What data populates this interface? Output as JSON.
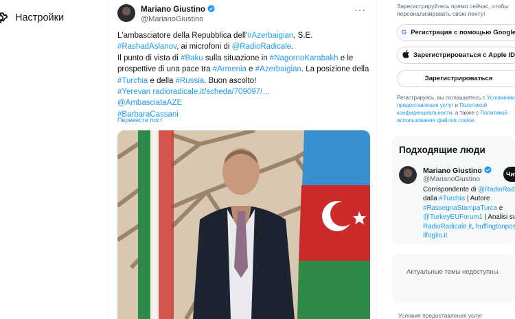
{
  "nav": {
    "settings_label": "Настройки",
    "settings_icon": "gear-icon"
  },
  "tweet": {
    "author_name": "Mariano Giustino",
    "author_handle": "@MarianoGiustino",
    "text_segments": {
      "s1": "L'ambasciatore della Repubblica dell'",
      "h1": "#Azerbaigian",
      "s2": ", S.E.",
      "h2": "#RashadAslanov",
      "s3": ", ai microfoni di ",
      "m1": "@RadioRadicale",
      "s4": ".",
      "s5": "Il punto di vista di ",
      "h3": "#Baku",
      "s6": " sulla situazione in ",
      "h4": "#NagornoKarabakh",
      "s7": " e le prospettive di una pace tra ",
      "h5": "#Armenia",
      "s8": " e ",
      "h6": "#Azerbaigian",
      "s9": ". La posizione della ",
      "h7": "#Turchia",
      "s10": " e della ",
      "h8": "#Russia",
      "s11": ". Buon ascolto!",
      "h9": "#Yerevan",
      "u1": "radioradicale.it/scheda/709097/…",
      "m2": "@AmbasciataAZE",
      "h10": "#BarbaraCassani"
    },
    "translate_label": "Перевести пост"
  },
  "signup": {
    "text": "Зарегистрируйтесь прямо сейчас, чтобы персонализировать свою ленту!",
    "google_label": "Регистрация с помощью Google",
    "apple_label": "Зарегистрироваться с Apple ID",
    "register_label": "Зарегистрироваться",
    "terms_pre": "Регистрируясь, вы соглашаетесь с ",
    "terms_link1": "Условиями предоставления услуг",
    "terms_mid": " и ",
    "terms_link2": "Политикой конфиденциальности",
    "terms_mid2": ", а также с ",
    "terms_link3": "Политикой использования файлов cookie",
    "terms_end": "."
  },
  "people": {
    "title": "Подходящие люди",
    "name": "Mariano Giustino",
    "handle": "@MarianoGiustino",
    "follow_label": "Читать",
    "bio": {
      "b1": "Corrispondente di ",
      "b1l": "@RadioRadicale",
      "b2": "dalla ",
      "b2l": "#Turchia",
      "b2e": " | Autore",
      "b3l": "#RassegnaStampaTurca",
      "b3e": " e",
      "b4l": "@TurkeyEUForum1",
      "b4e": " | Analisi su",
      "b5l": "RadioRadicale.it",
      "b5m": ", ",
      "b5l2": "huffingtonpost.it",
      "b6l": "ilfoglio.it"
    }
  },
  "trends": {
    "unavailable": "Актуальные темы недоступны."
  },
  "footer": {
    "terms": "Условия предоставления услуг"
  },
  "colors": {
    "link": "#1d9bf0",
    "text": "#0f1419",
    "muted": "#536471"
  }
}
